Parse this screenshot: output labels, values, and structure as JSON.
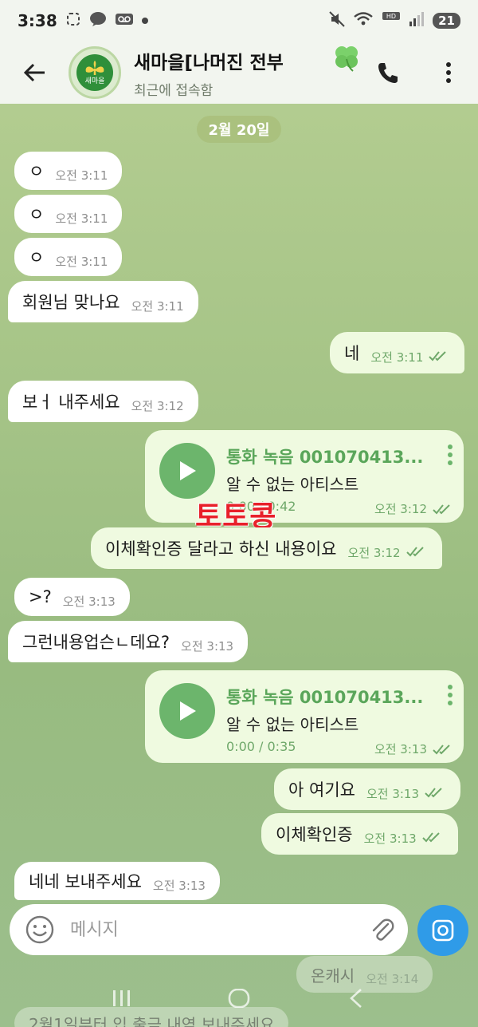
{
  "status_bar": {
    "time": "3:38",
    "battery": "21",
    "icons": [
      "screenshot-icon",
      "talk-icon",
      "voicemail-icon",
      "dot-icon",
      "mute-icon",
      "wifi-icon",
      "hd-voice-icon",
      "signal-icon"
    ]
  },
  "header": {
    "title": "새마을[나머진 전부",
    "subtitle": "최근에 접속함",
    "avatar_text": "새마을",
    "icons": [
      "back-arrow-icon",
      "clover-icon",
      "phone-icon",
      "more-vert-icon"
    ]
  },
  "date_separator": "2월 20일",
  "messages": [
    {
      "text": "ㅇ",
      "time": "오전 3:11"
    },
    {
      "text": "ㅇ",
      "time": "오전 3:11"
    },
    {
      "text": "ㅇ",
      "time": "오전 3:11"
    },
    {
      "text": "회원님 맞나요",
      "time": "오전 3:11"
    },
    {
      "text": "네",
      "time": "오전 3:11"
    },
    {
      "text": "보ㅓ 내주세요",
      "time": "오전 3:12"
    },
    {
      "audio_title": "통화 녹음 001070413...",
      "artist": "알 수 없는 아티스트",
      "duration": "0:00 / 0:42",
      "time": "오전 3:12"
    },
    {
      "text": "이체확인증 달라고 하신 내용이요",
      "time": "오전 3:12"
    },
    {
      "text": ">?",
      "time": "오전 3:13"
    },
    {
      "text": "그런내용업슨ㄴ데요?",
      "time": "오전 3:13"
    },
    {
      "audio_title": "통화 녹음 001070413...",
      "artist": "알 수 없는 아티스트",
      "duration": "0:00 / 0:35",
      "time": "오전 3:13"
    },
    {
      "text": "아 여기요",
      "time": "오전 3:13"
    },
    {
      "text": "이체확인증",
      "time": "오전 3:13"
    },
    {
      "text": "네네 보내주세요",
      "time": "오전 3:13"
    },
    {
      "text": "온캐시",
      "time": "오전 3:14"
    },
    {
      "text": "2월1일부터 입 출금 내역 보내주세요"
    }
  ],
  "watermark": "토토콩",
  "composer": {
    "placeholder": "메시지"
  },
  "colors": {
    "outgoing_bubble": "#effae0",
    "incoming_bubble": "#ffffff",
    "accent_green": "#6cb56c",
    "camera_button": "#2f9be8",
    "watermark": "#e8202a"
  }
}
